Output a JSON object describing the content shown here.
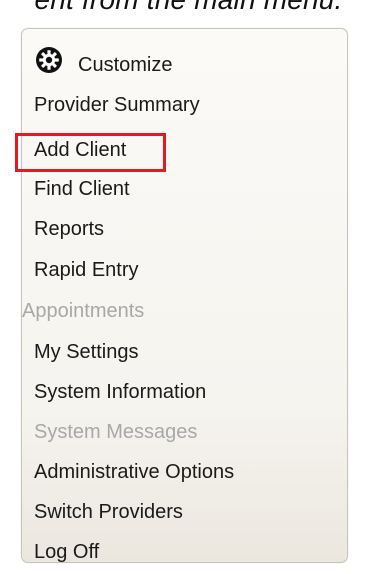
{
  "caption": "ent from the main menu.",
  "highlight_color": "#e21b23",
  "menu": {
    "customize": {
      "label": "Customize",
      "icon": "gear-icon"
    },
    "items": [
      {
        "label": "Provider Summary",
        "enabled": true
      },
      {
        "label": "Add Client",
        "enabled": true,
        "highlighted": true
      },
      {
        "label": "Find Client",
        "enabled": true
      },
      {
        "label": "Reports",
        "enabled": true
      },
      {
        "label": "Rapid Entry",
        "enabled": true
      },
      {
        "label": "Appointments",
        "enabled": false
      },
      {
        "label": "My Settings",
        "enabled": true
      },
      {
        "label": "System Information",
        "enabled": true
      },
      {
        "label": "System Messages",
        "enabled": false
      },
      {
        "label": "Administrative Options",
        "enabled": true
      },
      {
        "label": "Switch Providers",
        "enabled": true
      },
      {
        "label": "Log Off",
        "enabled": true
      }
    ]
  }
}
